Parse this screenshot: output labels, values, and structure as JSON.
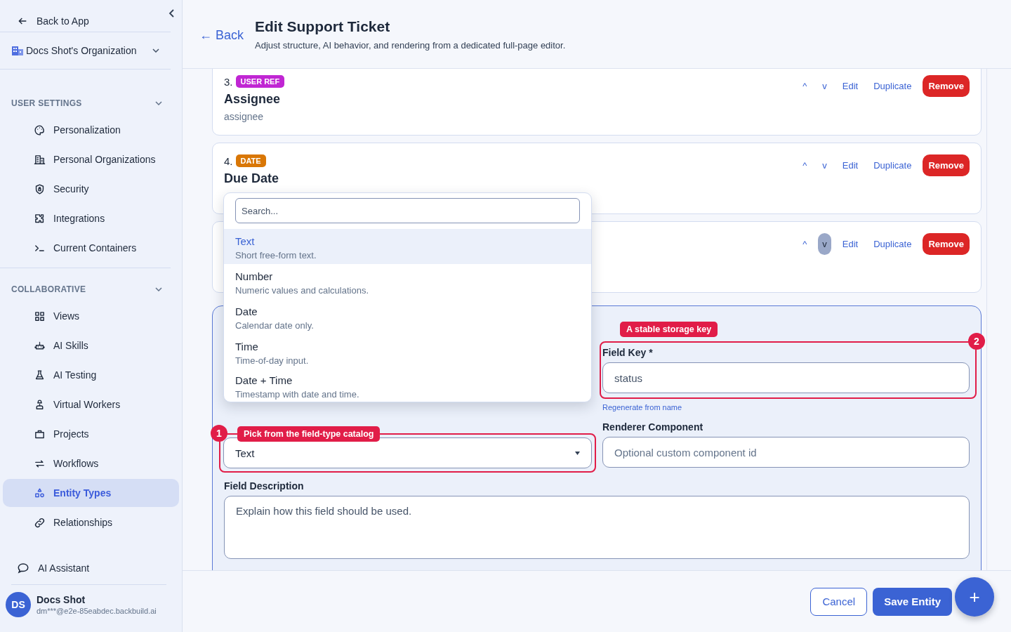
{
  "sidebar": {
    "back_link": "Back to App",
    "organization": "Docs Shot's Organization",
    "sections": [
      {
        "title": "USER SETTINGS",
        "expanded": true,
        "items": [
          {
            "label": "Personalization",
            "selected": false
          },
          {
            "label": "Personal Organizations",
            "selected": false
          },
          {
            "label": "Security",
            "selected": false
          },
          {
            "label": "Integrations",
            "selected": false
          },
          {
            "label": "Current Containers",
            "selected": false
          }
        ]
      },
      {
        "title": "COLLABORATIVE",
        "expanded": true,
        "items": [
          {
            "label": "Views",
            "selected": false
          },
          {
            "label": "AI Skills",
            "selected": false
          },
          {
            "label": "AI Testing",
            "selected": false
          },
          {
            "label": "Virtual Workers",
            "selected": false
          },
          {
            "label": "Projects",
            "selected": false
          },
          {
            "label": "Workflows",
            "selected": false
          },
          {
            "label": "Entity Types",
            "selected": true
          },
          {
            "label": "Relationships",
            "selected": false
          }
        ]
      }
    ],
    "assistant": "AI Assistant",
    "user": {
      "initials": "DS",
      "name": "Docs Shot",
      "email": "dm***@e2e-85eabdec.backbuild.ai"
    }
  },
  "header": {
    "back": "← Back",
    "title": "Edit Support Ticket",
    "subtitle": "Adjust structure, AI behavior, and rendering from a dedicated full-page editor."
  },
  "fields": [
    {
      "number": "3.",
      "badge": "USER REF",
      "color": "#c026d3",
      "title": "Assignee",
      "key": "assignee",
      "actions": {
        "up": "^",
        "down": "v",
        "edit": "Edit",
        "duplicate": "Duplicate",
        "remove": "Remove",
        "down_focused": false
      }
    },
    {
      "number": "4.",
      "badge": "DATE",
      "color": "#d97706",
      "title": "Due Date",
      "actions": {
        "up": "^",
        "down": "v",
        "edit": "Edit",
        "duplicate": "Duplicate",
        "remove": "Remove",
        "down_focused": false
      }
    },
    {
      "actions": {
        "up": "^",
        "down": "v",
        "edit": "Edit",
        "duplicate": "Duplicate",
        "remove": "Remove",
        "down_focused": true
      }
    }
  ],
  "type_menu": {
    "search_placeholder": "Search...",
    "options": [
      {
        "title": "Text",
        "description": "Short free-form text.",
        "selected": true
      },
      {
        "title": "Number",
        "description": "Numeric values and calculations.",
        "selected": false
      },
      {
        "title": "Date",
        "description": "Calendar date only.",
        "selected": false
      },
      {
        "title": "Time",
        "description": "Time-of-day input.",
        "selected": false
      },
      {
        "title": "Date + Time",
        "description": "Timestamp with date and time.",
        "selected": false
      }
    ]
  },
  "editor": {
    "field_type": {
      "value": "Text",
      "callout": {
        "number": "1",
        "text": "Pick from the field-type catalog"
      }
    },
    "field_key": {
      "label": "Field Key *",
      "value": "status",
      "callout": {
        "number": "2",
        "text": "A stable storage key"
      }
    },
    "regenerate_link": "Regenerate from name",
    "renderer": {
      "label": "Renderer Component",
      "placeholder": "Optional custom component id"
    },
    "description": {
      "label": "Field Description",
      "placeholder": "Explain how this field should be used."
    }
  },
  "footer": {
    "cancel": "Cancel",
    "save": "Save Entity",
    "fab": "+"
  }
}
